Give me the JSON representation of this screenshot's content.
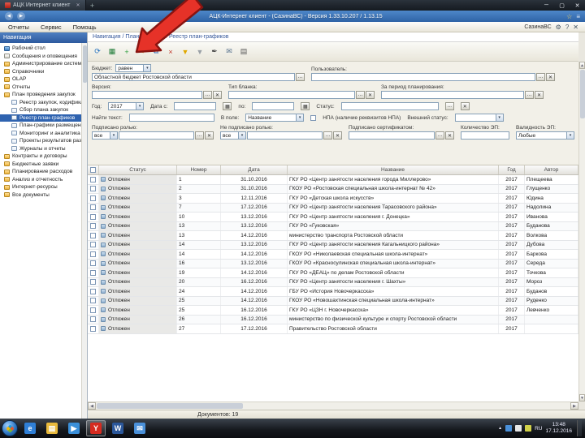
{
  "browser": {
    "tab_title": "АЦК Интернет клиент",
    "tab_close": "✕",
    "new_tab_label": "+",
    "back": "◀",
    "forward": "▶",
    "address_title": "АЦК-Интернет клиент - (СазинаВС) - Версия 1.33.10.207 / 1.13.15",
    "star": "☆",
    "menu_glyph": "≡",
    "win_min": "─",
    "win_max": "▢",
    "win_close": "✕"
  },
  "app": {
    "menus": [
      {
        "label": "Отчеты"
      },
      {
        "label": "Сервис"
      },
      {
        "label": "Помощь"
      }
    ],
    "user": "СазинаВС",
    "breadcrumb": "Навигация / Планирование / Реестр план-графиков"
  },
  "tree": {
    "header": "Навигация",
    "items": [
      {
        "label": "Рабочий стол",
        "level": 0,
        "icon": "desktop"
      },
      {
        "label": "Сообщения и оповещения",
        "level": 0,
        "icon": "mail"
      },
      {
        "label": "Администрирование системы",
        "level": 0,
        "icon": "folder"
      },
      {
        "label": "Справочники",
        "level": 0,
        "icon": "folder"
      },
      {
        "label": "OLAP",
        "level": 0,
        "icon": "folder"
      },
      {
        "label": "Отчеты",
        "level": 0,
        "icon": "folder"
      },
      {
        "label": "План проведения закупок",
        "level": 0,
        "icon": "folder"
      },
      {
        "label": "Реестр закупок, кодификация",
        "level": 1,
        "icon": "doc"
      },
      {
        "label": "Сбор плана закупок",
        "level": 1,
        "icon": "doc"
      },
      {
        "label": "Реестр план-графиков",
        "level": 1,
        "icon": "doc",
        "selected": true
      },
      {
        "label": "План-графики размещения",
        "level": 1,
        "icon": "doc"
      },
      {
        "label": "Мониторинг и аналитика",
        "level": 1,
        "icon": "doc"
      },
      {
        "label": "Проекты результатов развития",
        "level": 1,
        "icon": "doc"
      },
      {
        "label": "Журналы и отчеты",
        "level": 1,
        "icon": "doc"
      },
      {
        "label": "Контракты и договоры",
        "level": 0,
        "icon": "folder"
      },
      {
        "label": "Бюджетные заявки",
        "level": 0,
        "icon": "folder"
      },
      {
        "label": "Планирование расходов",
        "level": 0,
        "icon": "folder"
      },
      {
        "label": "Анализ и отчетность",
        "level": 0,
        "icon": "folder"
      },
      {
        "label": "Интернет-ресурсы",
        "level": 0,
        "icon": "folder"
      },
      {
        "label": "Все документы",
        "level": 0,
        "icon": "folder"
      }
    ]
  },
  "toolbar": {
    "icons": [
      {
        "name": "refresh-icon",
        "glyph": "⟳",
        "color": "#1f6fbf"
      },
      {
        "name": "export-excel-icon",
        "glyph": "▦",
        "color": "#1d7a36"
      },
      {
        "name": "new-icon",
        "glyph": "+",
        "color": "#2e9e3c"
      },
      {
        "name": "edit-icon",
        "glyph": "✎",
        "color": "#c07c00"
      },
      {
        "name": "copy-icon",
        "glyph": "⧉",
        "color": "#3b6fb5"
      },
      {
        "name": "delete-icon",
        "glyph": "×",
        "color": "#c0392b"
      },
      {
        "name": "filter-icon",
        "glyph": "▼",
        "color": "#e0a800"
      },
      {
        "name": "clear-filter-icon",
        "glyph": "▼",
        "color": "#9aa0a6"
      },
      {
        "name": "sign-icon",
        "glyph": "✒",
        "color": "#444444"
      },
      {
        "name": "send-icon",
        "glyph": "✉",
        "color": "#55708c"
      },
      {
        "name": "print-icon",
        "glyph": "▤",
        "color": "#555555"
      }
    ]
  },
  "filters": {
    "budget_label": "Бюджет:",
    "budget_op": "равен",
    "budget_value": "Областной бюджет Ростовской области",
    "user_label": "Пользователь:",
    "version_label": "Версия:",
    "blank_type_label": "Тип бланка:",
    "period_label": "За период планирования:",
    "year_label": "Год:",
    "year_value": "2017",
    "date_from_label": "Дата с:",
    "date_to_label": "по:",
    "status_label": "Статус:",
    "search_label": "Найти текст:",
    "in_field_label": "В поле:",
    "in_field_value": "Название",
    "npa_label": "НПА (наличие реквизитов НПА)",
    "ext_status_label": "Внешний статус:",
    "signed_role_label": "Подписано ролью:",
    "signed_role_op": "все",
    "not_signed_role_label": "Не подписано ролью:",
    "not_signed_role_op": "все",
    "signed_cert_label": "Подписано сертификатом:",
    "ep_count_label": "Количество ЭП:",
    "ep_valid_label": "Валидность ЭП:",
    "ep_valid_value": "Любые",
    "ellipsis": "…",
    "clear": "✕",
    "calendar": "▦"
  },
  "table": {
    "headers": {
      "status": "Статус",
      "num": "Номер",
      "date": "Дата",
      "name": "Название",
      "year": "Год",
      "author": "Автор"
    },
    "rows": [
      {
        "status": "Отложен",
        "num": "1",
        "date": "31.10.2016",
        "name": "ГКУ РО «Центр занятости населения города Миллерово»",
        "year": "2017",
        "author": "Плещеева"
      },
      {
        "status": "Отложен",
        "num": "2",
        "date": "31.10.2016",
        "name": "ГКОУ РО «Ростовская специальная школа-интернат № 42»",
        "year": "2017",
        "author": "Глущенко"
      },
      {
        "status": "Отложен",
        "num": "3",
        "date": "12.11.2016",
        "name": "ГКУ РО «Детская школа искусств»",
        "year": "2017",
        "author": "Юдина"
      },
      {
        "status": "Отложен",
        "num": "7",
        "date": "17.12.2016",
        "name": "ГКУ РО «Центр занятости населения Тарасовского района»",
        "year": "2017",
        "author": "Надолина"
      },
      {
        "status": "Отложен",
        "num": "10",
        "date": "13.12.2016",
        "name": "ГКУ РО «Центр занятости населения г. Донецка»",
        "year": "2017",
        "author": "Иванова"
      },
      {
        "status": "Отложен",
        "num": "13",
        "date": "13.12.2016",
        "name": "ГКУ РО «Гуковская»",
        "year": "2017",
        "author": "Буданова"
      },
      {
        "status": "Отложен",
        "num": "13",
        "date": "14.12.2016",
        "name": "министерство транспорта Ростовской области",
        "year": "2017",
        "author": "Волкова"
      },
      {
        "status": "Отложен",
        "num": "14",
        "date": "13.12.2016",
        "name": "ГКУ РО «Центр занятости населения Кагальницкого района»",
        "year": "2017",
        "author": "Дубова"
      },
      {
        "status": "Отложен",
        "num": "14",
        "date": "14.12.2016",
        "name": "ГКОУ РО «Николаевская специальная школа-интернат»",
        "year": "2017",
        "author": "Баркова"
      },
      {
        "status": "Отложен",
        "num": "16",
        "date": "13.12.2016",
        "name": "ГКОУ РО «Красносулинская специальная школа-интернат»",
        "year": "2017",
        "author": "Середа"
      },
      {
        "status": "Отложен",
        "num": "19",
        "date": "14.12.2016",
        "name": "ГКУ РО «ДЕАЦ» по делам Ростовской области",
        "year": "2017",
        "author": "Точкова"
      },
      {
        "status": "Отложен",
        "num": "20",
        "date": "16.12.2016",
        "name": "ГКУ РО «Центр занятости населения г. Шахты»",
        "year": "2017",
        "author": "Мороз"
      },
      {
        "status": "Отложен",
        "num": "24",
        "date": "14.12.2016",
        "name": "ГБУ РО «История Новочеркасска»",
        "year": "2017",
        "author": "Буданов"
      },
      {
        "status": "Отложен",
        "num": "25",
        "date": "14.12.2016",
        "name": "ГКОУ РО «Новошахтинская специальная школа-интернат»",
        "year": "2017",
        "author": "Руденко"
      },
      {
        "status": "Отложен",
        "num": "25",
        "date": "16.12.2016",
        "name": "ГКУ РО «ЦЗН г. Новочеркасска»",
        "year": "2017",
        "author": "Левченко"
      },
      {
        "status": "Отложен",
        "num": "26",
        "date": "16.12.2016",
        "name": "министерство по физической культуре и спорту Ростовской области",
        "year": "2017",
        "author": ""
      },
      {
        "status": "Отложен",
        "num": "27",
        "date": "17.12.2016",
        "name": "Правительство Ростовской области",
        "year": "2017",
        "author": ""
      }
    ]
  },
  "status": {
    "count": "Документов: 19"
  },
  "taskbar": {
    "icons": [
      {
        "name": "taskbar-ie",
        "glyph": "e",
        "bg": "#2f7fd6"
      },
      {
        "name": "taskbar-explorer",
        "glyph": "▤",
        "bg": "#e8b93c"
      },
      {
        "name": "taskbar-media",
        "glyph": "▶",
        "bg": "#3a8fd9"
      },
      {
        "name": "taskbar-browser",
        "glyph": "Y",
        "bg": "#d62b20",
        "active": true
      },
      {
        "name": "taskbar-word",
        "glyph": "W",
        "bg": "#2b579a"
      },
      {
        "name": "taskbar-mail",
        "glyph": "✉",
        "bg": "#4a90d9"
      }
    ],
    "tray": {
      "expand": "▲",
      "lang": "RU",
      "time": "13:48",
      "date": "17.12.2016"
    }
  }
}
